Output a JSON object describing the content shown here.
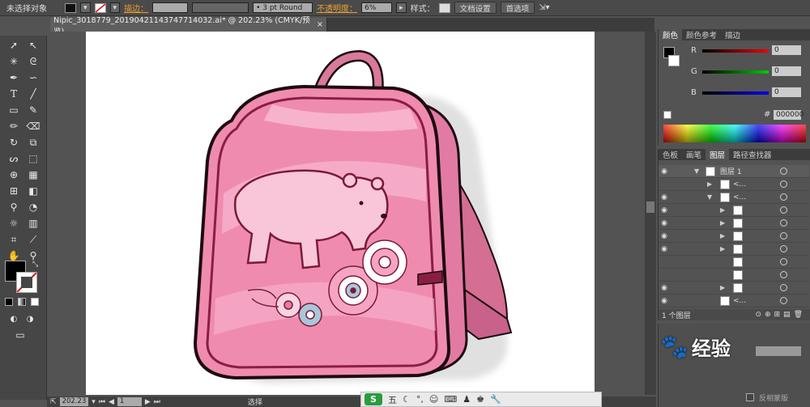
{
  "control_bar": {
    "selection_status": "未选择对象",
    "stroke_label": "描边：",
    "brush_value": "• 3 pt Round",
    "opacity_label": "不透明度：",
    "opacity_value": "6%",
    "style_label": "样式：",
    "doc_settings": "文档设置",
    "preferences": "首选项"
  },
  "document": {
    "tab_title": "Nipic_3018779_20190421143747714032.ai* @ 202.23% (CMYK/预览)",
    "close": "×"
  },
  "color_panel": {
    "tabs": [
      "颜色",
      "颜色参考",
      "描边"
    ],
    "labels": {
      "r": "R",
      "g": "G",
      "b": "B",
      "hash": "#"
    },
    "values": {
      "r": "0",
      "g": "0",
      "b": "0",
      "hex": "000000"
    }
  },
  "layers_panel": {
    "tabs": [
      "色板",
      "画笔",
      "图层",
      "路径查找器"
    ],
    "top_layer": "图层 1",
    "sub_label": "<...",
    "count": "1 个图层"
  },
  "bottom_panel": {
    "option": "反相蒙版"
  },
  "status": {
    "zoom": "202.23",
    "page": "1",
    "tool": "选择"
  },
  "taskbar": {
    "ime": "五"
  },
  "watermark": "经验",
  "colors": {
    "bag_main": "#f08bb0",
    "bag_light": "#f7b6cf",
    "bag_dark": "#7a1a38",
    "outline": "#2a0d16"
  }
}
